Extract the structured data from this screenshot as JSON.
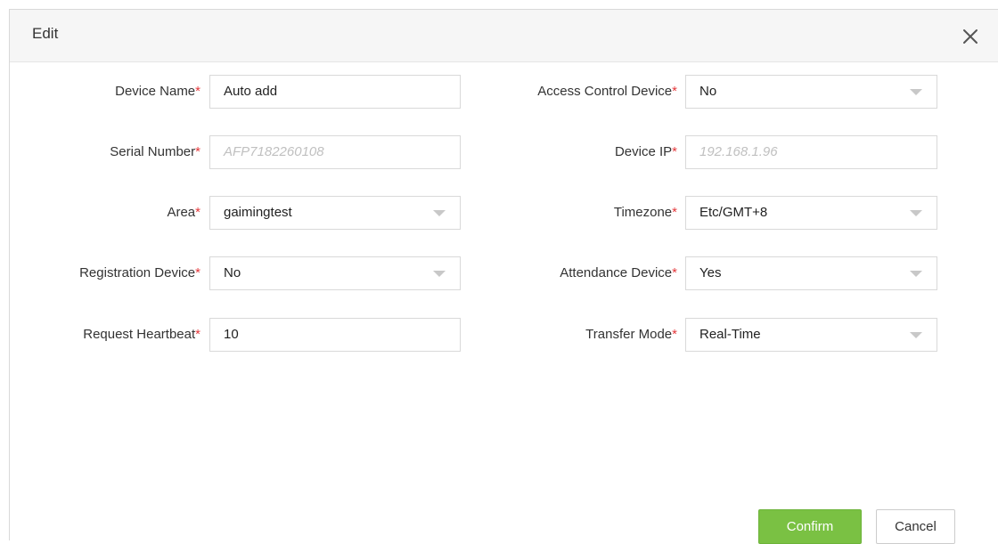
{
  "dialog": {
    "title": "Edit",
    "close_icon": "close-icon"
  },
  "fields": {
    "device_name": {
      "label": "Device Name",
      "value": "Auto add"
    },
    "serial_number": {
      "label": "Serial Number",
      "value": "AFP7182260108"
    },
    "area": {
      "label": "Area",
      "value": "gaimingtest"
    },
    "registration_device": {
      "label": "Registration Device",
      "value": "No"
    },
    "request_heartbeat": {
      "label": "Request Heartbeat",
      "value": "10"
    },
    "access_control_device": {
      "label": "Access Control Device",
      "value": "No"
    },
    "device_ip": {
      "label": "Device IP",
      "value": "192.168.1.96"
    },
    "timezone": {
      "label": "Timezone",
      "value": "Etc/GMT+8"
    },
    "attendance_device": {
      "label": "Attendance Device",
      "value": "Yes"
    },
    "transfer_mode": {
      "label": "Transfer Mode",
      "value": "Real-Time"
    }
  },
  "required_marker": "*",
  "buttons": {
    "confirm": "Confirm",
    "cancel": "Cancel"
  },
  "colors": {
    "confirm_bg": "#7ac143",
    "required": "#e4393c",
    "header_bg": "#f6f6f6"
  }
}
